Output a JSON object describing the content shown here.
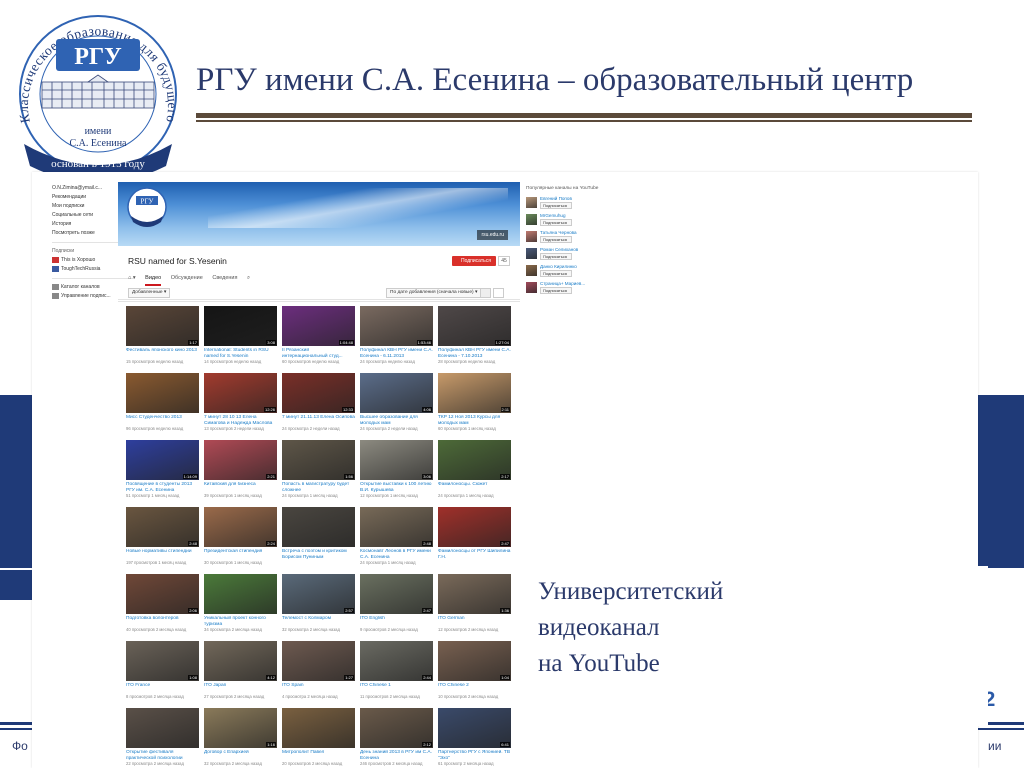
{
  "logo": {
    "ring_text": "Классическое образование для будущего",
    "abbrev": "РГУ",
    "name_line1": "имени",
    "name_line2": "С.А. Есенина",
    "ribbon": "основан в 1915 году",
    "colors": {
      "blue": "#1f3a78",
      "light_blue": "#2f63b3"
    }
  },
  "slide": {
    "title": "РГУ имени С.А. Есенина – образовательный центр",
    "caption": [
      "Университетский",
      "видеоканал",
      "на YouTube"
    ],
    "page_number": "12",
    "footer_left": "Фо",
    "footer_right": "ии",
    "colors": {
      "title": "#2b3a6b",
      "band": "#1f3a78",
      "rule": "#5b4a3a"
    }
  },
  "youtube": {
    "sidebar": {
      "items": [
        "O.N.Zimina@ymail.c...",
        "Рекомендации",
        "Мои подписки",
        "Социальные сети",
        "История",
        "Посмотреть позже"
      ],
      "subs_heading": "Подписки",
      "subscriptions": [
        "This is Хорошо",
        "ToughTechRussia"
      ],
      "bottom_items": [
        "Каталог каналов",
        "Управление подпис..."
      ]
    },
    "banner": {
      "logo_text": "РГУ",
      "url": "rsu.edu.ru"
    },
    "channel": {
      "name": "RSU named for S.Yesenin",
      "subscribe": "Подписаться",
      "sub_count": "45",
      "tabs": [
        "Видео",
        "Обсуждение",
        "Сведения"
      ]
    },
    "filters": {
      "left": "Добавленные ▾",
      "right": "По дате добавления (сначала новые) ▾"
    },
    "videos": [
      {
        "title": "Фестиваль японского кино 2013",
        "views": "15 просмотров",
        "ago": "неделю назад",
        "dur": "1:17",
        "bg": "#5a4638"
      },
      {
        "title": "International: Students in RSU named for S.Yesenin",
        "views": "14 просмотров",
        "ago": "неделю назад",
        "dur": "3:08",
        "bg": "#151515"
      },
      {
        "title": "II Рязанский интернациональный студ...",
        "views": "60 просмотров",
        "ago": "неделю назад",
        "dur": "1:04:48",
        "bg": "#6c2e7e"
      },
      {
        "title": "Полуфинал КВН РГУ имени С.А. Есенина - 6.11.2013",
        "views": "24 просмотра",
        "ago": "неделю назад",
        "dur": "1:53:46",
        "bg": "#7a6a60"
      },
      {
        "title": "Полуфинал КВН РГУ имени С.А. Есенина - 7.10.2013",
        "views": "28 просмотров",
        "ago": "неделю назад",
        "dur": "1:27:04",
        "bg": "#4f4848"
      },
      {
        "title": "Мисс Студенчество 2013",
        "views": "96 просмотров",
        "ago": "неделю назад",
        "dur": "",
        "bg": "#8a5a30"
      },
      {
        "title": "7 минут 28 10 13 Елена Симагова и Надежда Маслова",
        "views": "13 просмотров",
        "ago": "2 недели назад",
        "dur": "12:26",
        "bg": "#a23b2e"
      },
      {
        "title": "7 минут 21.11.13 Елена Осипова",
        "views": "24 просмотра",
        "ago": "2 недели назад",
        "dur": "12:33",
        "bg": "#7a2f28"
      },
      {
        "title": "Высшее образование для молодых мам",
        "views": "24 просмотра",
        "ago": "2 недели назад",
        "dur": "4:06",
        "bg": "#5b6d8a"
      },
      {
        "title": "ТКР 12 Ноя 2013 Курсы для молодых мам",
        "views": "60 просмотров",
        "ago": "1 месяц назад",
        "dur": "2:11",
        "bg": "#c79a6a"
      },
      {
        "title": "Посвящение в студенты 2013 РГУ им. С.А. Есенина",
        "views": "51 просмотр",
        "ago": "1 месяц назад",
        "dur": "1:14:09",
        "bg": "#2e3f9e"
      },
      {
        "title": "Китайский для бизнеса",
        "views": "39 просмотров",
        "ago": "1 месяц назад",
        "dur": "2:21",
        "bg": "#b04a55"
      },
      {
        "title": "Попасть в магистратуру будет сложнее",
        "views": "24 просмотра",
        "ago": "1 месяц назад",
        "dur": "1:56",
        "bg": "#5e5648"
      },
      {
        "title": "Открытие выставки к 100 летию В.И. Курышева",
        "views": "12 просмотров",
        "ago": "1 месяц назад",
        "dur": "3:06",
        "bg": "#8c8a80"
      },
      {
        "title": "Фамилоносцы. Сюжет",
        "views": "24 просмотра",
        "ago": "1 месяц назад",
        "dur": "2:17",
        "bg": "#4d6a38"
      },
      {
        "title": "Новые нормативы стипендии",
        "views": "197 просмотров",
        "ago": "1 месяц назад",
        "dur": "2:48",
        "bg": "#6a5640"
      },
      {
        "title": "Президентская стипендия",
        "views": "30 просмотров",
        "ago": "1 месяц назад",
        "dur": "2:24",
        "bg": "#9a6a4a"
      },
      {
        "title": "Встреча с поэтом и критиком Борисом Пуниным",
        "views": "",
        "ago": "",
        "dur": "",
        "bg": "#4a4640"
      },
      {
        "title": "Космонавт Леонов в РГУ имени С.А. Есенина",
        "views": "24 просмотра",
        "ago": "1 месяц назад",
        "dur": "2:48",
        "bg": "#786a58"
      },
      {
        "title": "Фамилоносцы от РГУ Шипилина Г.Н.",
        "views": "",
        "ago": "",
        "dur": "2:47",
        "bg": "#a0302a"
      },
      {
        "title": "Подготовка волонтеров",
        "views": "40 просмотров",
        "ago": "2 месяца назад",
        "dur": "2:06",
        "bg": "#704838"
      },
      {
        "title": "Уникальный проект конного туризма",
        "views": "34 просмотра",
        "ago": "2 месяца назад",
        "dur": "",
        "bg": "#4b7a3a"
      },
      {
        "title": "Телемост с Колмаром",
        "views": "32 просмотра",
        "ago": "2 месяца назад",
        "dur": "2:57",
        "bg": "#5a6a7a"
      },
      {
        "title": "ITO English",
        "views": "9 просмотров",
        "ago": "2 месяца назад",
        "dur": "2:47",
        "bg": "#6a7060"
      },
      {
        "title": "ITO German",
        "views": "12 просмотров",
        "ago": "2 месяца назад",
        "dur": "1:36",
        "bg": "#7a6a5a"
      },
      {
        "title": "ITO France",
        "views": "8 просмотров",
        "ago": "2 месяца назад",
        "dur": "1:08",
        "bg": "#6a6258"
      },
      {
        "title": "ITO Japan",
        "views": "27 просмотров",
        "ago": "2 месяца назад",
        "dur": "4:12",
        "bg": "#72685a"
      },
      {
        "title": "ITO Spain",
        "views": "4 просмотра",
        "ago": "2 месяца назад",
        "dur": "1:27",
        "bg": "#6e5a50"
      },
      {
        "title": "ITO Chinese 1",
        "views": "11 просмотров",
        "ago": "2 месяца назад",
        "dur": "2:44",
        "bg": "#6a6a62"
      },
      {
        "title": "ITO Chinese 2",
        "views": "10 просмотров",
        "ago": "2 месяца назад",
        "dur": "1:04",
        "bg": "#786050"
      },
      {
        "title": "Открытие фестиваля практической психологии",
        "views": "22 просмотра",
        "ago": "2 месяца назад",
        "dur": "",
        "bg": "#5a5048"
      },
      {
        "title": "Договор с Епархией",
        "views": "32 просмотра",
        "ago": "2 месяца назад",
        "dur": "1:16",
        "bg": "#8a7a5a"
      },
      {
        "title": "Митрополит Павел",
        "views": "20 просмотров",
        "ago": "2 месяца назад",
        "dur": "",
        "bg": "#7a6040"
      },
      {
        "title": "День знаний 2013 в РГУ им С.А. Есенина",
        "views": "246 просмотров",
        "ago": "2 месяца назад",
        "dur": "2:12",
        "bg": "#6a5a4a"
      },
      {
        "title": "Партнерство РГУ с Японией. ТВ \"Эхо\"",
        "views": "61 просмотр",
        "ago": "2 месяца назад",
        "dur": "6:41",
        "bg": "#3a4a6a"
      }
    ],
    "popular": {
      "heading": "Популярные каналы на YouTube",
      "subscribe": "Подписаться",
      "channels": [
        {
          "name": "Евгений Попов",
          "avatar": "#b7977a"
        },
        {
          "name": "MrGemuhug",
          "avatar": "#6a8a5a"
        },
        {
          "name": "Татьяна Чернова",
          "avatar": "#c07a70"
        },
        {
          "name": "Роман Селиханов",
          "avatar": "#4a5a7a"
        },
        {
          "name": "Данко Кирилинко",
          "avatar": "#8a6a4a"
        },
        {
          "name": "Страница+ Мариев...",
          "avatar": "#a04a5a"
        }
      ]
    }
  }
}
